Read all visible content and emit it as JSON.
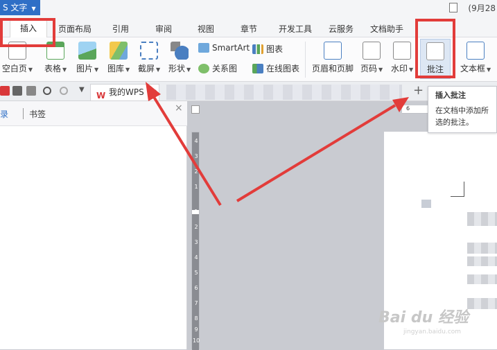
{
  "title_bar": {
    "app_label": "S 文字",
    "right_text": "(9月28"
  },
  "menu_tabs": [
    "插入",
    "页面布局",
    "引用",
    "审阅",
    "视图",
    "章节",
    "开发工具",
    "云服务",
    "文档助手"
  ],
  "ribbon": {
    "blank_page": "空白页",
    "table": "表格",
    "picture": "图片",
    "gallery": "图库",
    "screenshot": "截屏",
    "shape": "形状",
    "smartart": "SmartArt",
    "relation": "关系图",
    "chart": "图表",
    "online_chart": "在线图表",
    "header_footer": "页眉和页脚",
    "page_number": "页码",
    "watermark": "水印",
    "comment": "批注",
    "textbox": "文本框"
  },
  "doc_tab": {
    "label": "我的WPS",
    "close": "×"
  },
  "nav": {
    "tab_outline": "目录",
    "tab_bookmark": "书签",
    "close": "×"
  },
  "tooltip": {
    "title": "插入批注",
    "desc": "在文档中添加所选的批注。"
  },
  "ruler_numbers": [
    "4",
    "3",
    "2",
    "1",
    "1",
    "2",
    "3",
    "4",
    "5",
    "6",
    "7",
    "8",
    "9",
    "10"
  ],
  "hruler_number": "6",
  "watermark": {
    "main": "Bai du 经验",
    "sub": "jingyan.baidu.com"
  },
  "colors": {
    "accent": "#2f6fc6",
    "highlight": "#e23c3a"
  }
}
